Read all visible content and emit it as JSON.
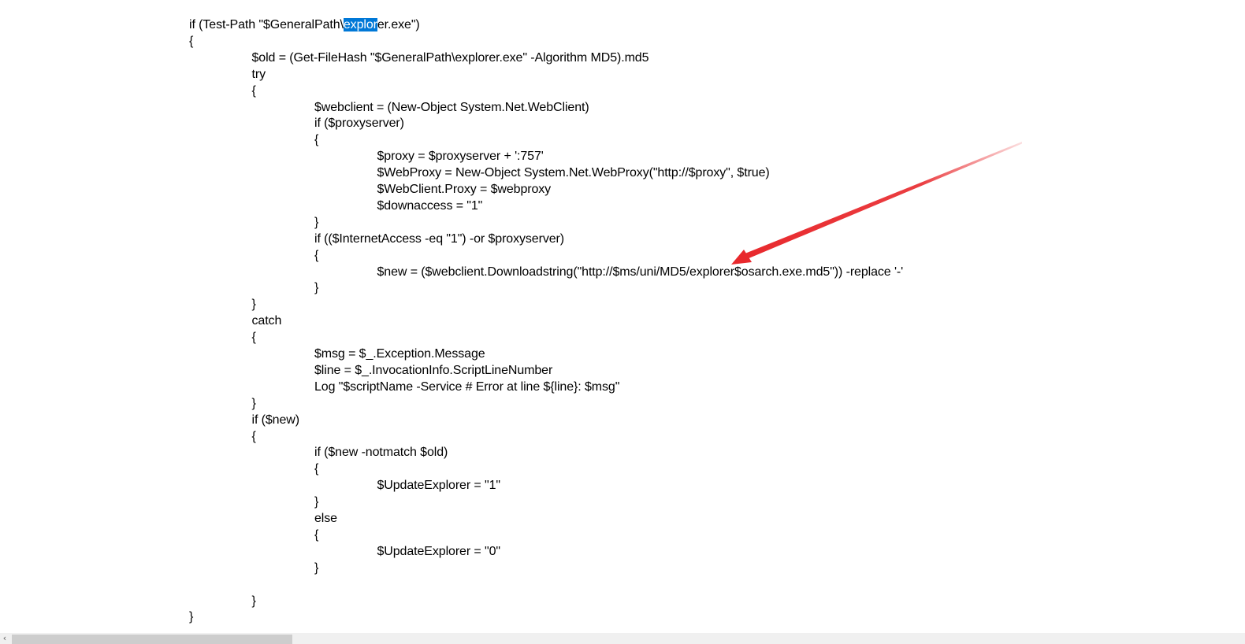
{
  "document": {
    "lines": [
      {
        "indent": 0,
        "text": "if (Test-Path \"$GeneralPath\\explorer.exe\")",
        "sel_start": 28,
        "sel_end": 34
      },
      {
        "indent": 0,
        "text": "{"
      },
      {
        "indent": 1,
        "text": "$old = (Get-FileHash \"$GeneralPath\\explorer.exe\" -Algorithm MD5).md5"
      },
      {
        "indent": 1,
        "text": "try"
      },
      {
        "indent": 1,
        "text": "{"
      },
      {
        "indent": 2,
        "text": "$webclient = (New-Object System.Net.WebClient)"
      },
      {
        "indent": 2,
        "text": "if ($proxyserver)"
      },
      {
        "indent": 2,
        "text": "{"
      },
      {
        "indent": 3,
        "text": "$proxy = $proxyserver + ':757'"
      },
      {
        "indent": 3,
        "text": "$WebProxy = New-Object System.Net.WebProxy(\"http://$proxy\", $true)"
      },
      {
        "indent": 3,
        "text": "$WebClient.Proxy = $webproxy"
      },
      {
        "indent": 3,
        "text": "$downaccess = \"1\""
      },
      {
        "indent": 2,
        "text": "}"
      },
      {
        "indent": 2,
        "text": "if (($InternetAccess -eq \"1\") -or $proxyserver)"
      },
      {
        "indent": 2,
        "text": "{"
      },
      {
        "indent": 3,
        "text": "$new = ($webclient.Downloadstring(\"http://$ms/uni/MD5/explorer$osarch.exe.md5\")) -replace '-'"
      },
      {
        "indent": 2,
        "text": "}"
      },
      {
        "indent": 1,
        "text": "}"
      },
      {
        "indent": 1,
        "text": "catch"
      },
      {
        "indent": 1,
        "text": "{"
      },
      {
        "indent": 2,
        "text": "$msg = $_.Exception.Message"
      },
      {
        "indent": 2,
        "text": "$line = $_.InvocationInfo.ScriptLineNumber"
      },
      {
        "indent": 2,
        "text": "Log \"$scriptName -Service # Error at line ${line}: $msg\""
      },
      {
        "indent": 1,
        "text": "}"
      },
      {
        "indent": 1,
        "text": "if ($new)"
      },
      {
        "indent": 1,
        "text": "{"
      },
      {
        "indent": 2,
        "text": "if ($new -notmatch $old)"
      },
      {
        "indent": 2,
        "text": "{"
      },
      {
        "indent": 3,
        "text": "$UpdateExplorer = \"1\""
      },
      {
        "indent": 2,
        "text": "}"
      },
      {
        "indent": 2,
        "text": "else"
      },
      {
        "indent": 2,
        "text": "{"
      },
      {
        "indent": 3,
        "text": "$UpdateExplorer = \"0\""
      },
      {
        "indent": 2,
        "text": "}"
      },
      {
        "indent": 2,
        "text": ""
      },
      {
        "indent": 1,
        "text": "}"
      },
      {
        "indent": 0,
        "text": "}"
      }
    ]
  },
  "annotation": {
    "type": "arrow",
    "color": "#e8282c",
    "target": "explorer"
  },
  "scrollbar": {
    "left_arrow_icon": "chevron-left-icon",
    "left_arrow_glyph": "‹"
  }
}
